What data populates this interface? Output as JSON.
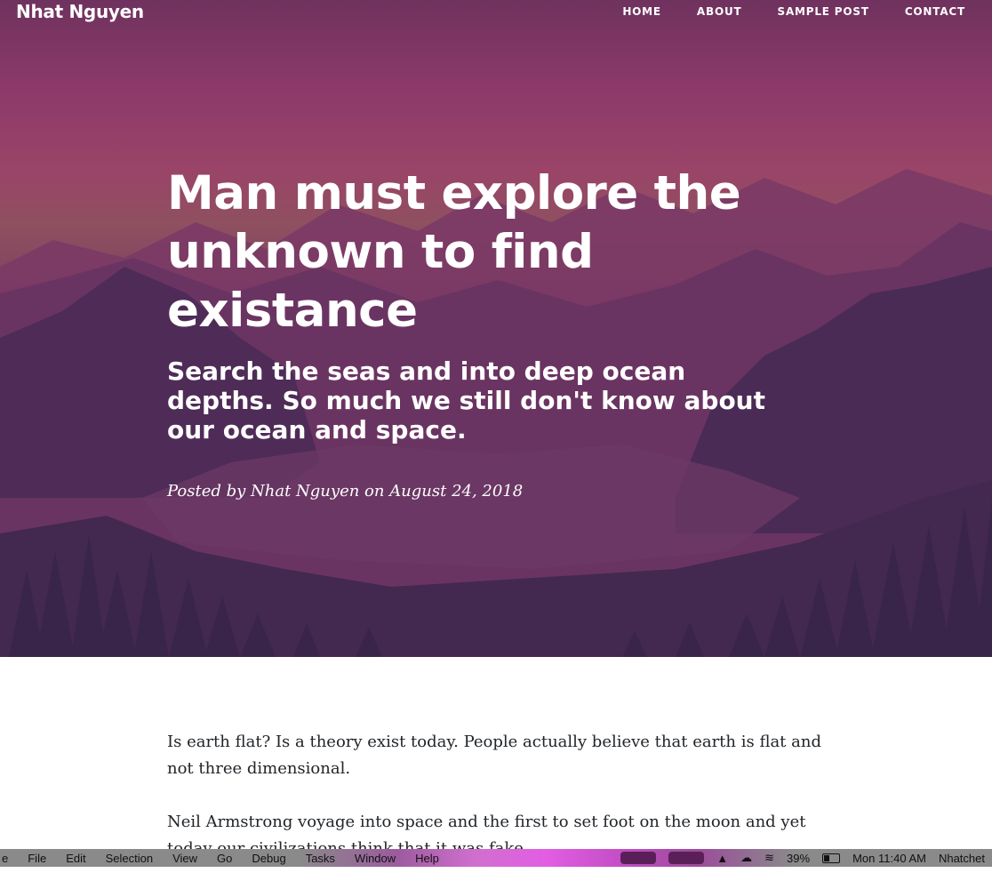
{
  "nav": {
    "brand": "Nhat Nguyen",
    "links": [
      "HOME",
      "ABOUT",
      "SAMPLE POST",
      "CONTACT"
    ]
  },
  "post": {
    "title": "Man must explore the unknown to find existance",
    "subtitle": "Search the seas and into deep ocean depths. So much we still don't know about our ocean and space.",
    "meta": "Posted by Nhat Nguyen on August 24, 2018",
    "paragraphs": [
      "Is earth flat? Is a theory exist today. People actually believe that earth is flat and not three dimensional.",
      "Neil Armstrong voyage into space and the first to set foot on the moon and yet today our civilizations think that it was fake."
    ]
  },
  "menubar": {
    "items": [
      "e",
      "File",
      "Edit",
      "Selection",
      "View",
      "Go",
      "Debug",
      "Tasks",
      "Window",
      "Help"
    ],
    "battery": "39%",
    "clock": "Mon 11:40 AM",
    "user": "Nhatchet",
    "icons": [
      "app-indicator-icon",
      "app-indicator-icon",
      "elephant-icon",
      "cloud-icon",
      "wifi-icon",
      "battery-icon"
    ]
  },
  "colors": {
    "hero_top": "#6f325e",
    "hero_bottom": "#3e2c52",
    "text": "#212529"
  }
}
